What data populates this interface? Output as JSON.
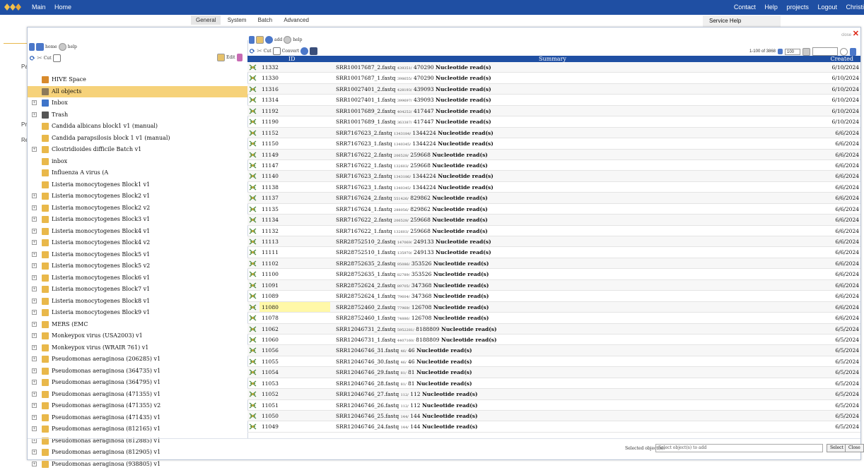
{
  "topbar": {
    "left": [
      "Main",
      "Home"
    ],
    "right": [
      "Contact",
      "Help",
      "projects",
      "Logout",
      "Christi"
    ]
  },
  "bg_tabs": [
    "General",
    "System",
    "Batch",
    "Advanced"
  ],
  "service_help": "Service Help",
  "bg_labels": [
    "Pa",
    "Pro",
    "Re"
  ],
  "left_toolbar": {
    "home_label": "home",
    "help_label": "help",
    "cut_label": "Cut",
    "edit_label": "Edit"
  },
  "tree": [
    {
      "label": "HIVE Space",
      "icon": "home",
      "exp": false
    },
    {
      "label": "All objects",
      "icon": "all",
      "exp": false,
      "selected": true
    },
    {
      "label": "Inbox",
      "icon": "blue",
      "exp": true
    },
    {
      "label": "Trash",
      "icon": "trash",
      "exp": true
    },
    {
      "label": "Candida albicans block1 v1 (manual)",
      "icon": "folder",
      "exp": false
    },
    {
      "label": "Candida parapsilosis block 1 v1 (manual)",
      "icon": "folder",
      "exp": false
    },
    {
      "label": "Clostridioides difficile Batch v1",
      "icon": "folder",
      "exp": true
    },
    {
      "label": "inbox",
      "icon": "folder",
      "exp": false
    },
    {
      "label": "Influenza A virus (A",
      "icon": "folder",
      "exp": false
    },
    {
      "label": "Listeria monocytogenes Block1 v1",
      "icon": "folder",
      "exp": false
    },
    {
      "label": "Listeria monocytogenes Block2 v1",
      "icon": "folder",
      "exp": true
    },
    {
      "label": "Listeria monocytogenes Block2 v2",
      "icon": "folder",
      "exp": true
    },
    {
      "label": "Listeria monocytogenes Block3 v1",
      "icon": "folder",
      "exp": true
    },
    {
      "label": "Listeria monocytogenes Block4 v1",
      "icon": "folder",
      "exp": true
    },
    {
      "label": "Listeria monocytogenes Block4 v2",
      "icon": "folder",
      "exp": true
    },
    {
      "label": "Listeria monocytogenes Block5 v1",
      "icon": "folder",
      "exp": true
    },
    {
      "label": "Listeria monocytogenes Block5 v2",
      "icon": "folder",
      "exp": true
    },
    {
      "label": "Listeria monocytogenes Block6 v1",
      "icon": "folder",
      "exp": true
    },
    {
      "label": "Listeria monocytogenes Block7 v1",
      "icon": "folder",
      "exp": true
    },
    {
      "label": "Listeria monocytogenes Block8 v1",
      "icon": "folder",
      "exp": true
    },
    {
      "label": "Listeria monocytogenes Block9 v1",
      "icon": "folder",
      "exp": true
    },
    {
      "label": "MERS (EMC",
      "icon": "folder",
      "exp": true
    },
    {
      "label": "Monkeypox virus (USA2003) v1",
      "icon": "folder",
      "exp": true
    },
    {
      "label": "Monkeypox virus (WRAIR 761) v1",
      "icon": "folder",
      "exp": true
    },
    {
      "label": "Pseudomonas aeraginosa (206285) v1",
      "icon": "folder",
      "exp": true
    },
    {
      "label": "Pseudomonas aeraginosa (364735) v1",
      "icon": "folder",
      "exp": true
    },
    {
      "label": "Pseudomonas aeraginosa (364795) v1",
      "icon": "folder",
      "exp": true
    },
    {
      "label": "Pseudomonas aeraginosa (471355) v1",
      "icon": "folder",
      "exp": true
    },
    {
      "label": "Pseudomonas aeraginosa (471355) v2",
      "icon": "folder",
      "exp": true
    },
    {
      "label": "Pseudomonas aeraginosa (471435) v1",
      "icon": "folder",
      "exp": true
    },
    {
      "label": "Pseudomonas aeraginosa (812165) v1",
      "icon": "folder",
      "exp": true
    },
    {
      "label": "Pseudomonas aeraginosa (812885) v1",
      "icon": "folder",
      "exp": true
    },
    {
      "label": "Pseudomonas aeraginosa (812905) v1",
      "icon": "folder",
      "exp": true
    },
    {
      "label": "Pseudomonas aeraginosa (938805) v1",
      "icon": "folder",
      "exp": true
    }
  ],
  "right_toolbar": {
    "help_label": "help",
    "add_label": "add",
    "cut_label": "Cut",
    "convert_label": "Convert",
    "close_label": "close"
  },
  "pager": {
    "range": "1-100 of 3868",
    "per_page": "100"
  },
  "grid": {
    "headers": {
      "id": "ID",
      "summary": "Summary",
      "created": "Created"
    },
    "rows": [
      {
        "id": "11332",
        "name": "SRR10017687_2.fastq",
        "small": "439351/",
        "count": "470290",
        "unit": "Nucleotide read(s)",
        "date": "6/10/2024"
      },
      {
        "id": "11330",
        "name": "SRR10017687_1.fastq",
        "small": "398655/",
        "count": "470290",
        "unit": "Nucleotide read(s)",
        "date": "6/10/2024"
      },
      {
        "id": "11316",
        "name": "SRR10027401_2.fastq",
        "small": "428193/",
        "count": "439093",
        "unit": "Nucleotide read(s)",
        "date": "6/10/2024"
      },
      {
        "id": "11314",
        "name": "SRR10027401_1.fastq",
        "small": "399697/",
        "count": "439093",
        "unit": "Nucleotide read(s)",
        "date": "6/10/2024"
      },
      {
        "id": "11192",
        "name": "SRR10017689_2.fastq",
        "small": "404252/",
        "count": "417447",
        "unit": "Nucleotide read(s)",
        "date": "6/10/2024"
      },
      {
        "id": "11190",
        "name": "SRR10017689_1.fastq",
        "small": "363387/",
        "count": "417447",
        "unit": "Nucleotide read(s)",
        "date": "6/10/2024"
      },
      {
        "id": "11152",
        "name": "SRR7167623_2.fastq",
        "small": "1343184/",
        "count": "1344224",
        "unit": "Nucleotide read(s)",
        "date": "6/6/2024"
      },
      {
        "id": "11150",
        "name": "SRR7167623_1.fastq",
        "small": "1340345/",
        "count": "1344224",
        "unit": "Nucleotide read(s)",
        "date": "6/6/2024"
      },
      {
        "id": "11149",
        "name": "SRR7167622_2.fastq",
        "small": "206528/",
        "count": "259668",
        "unit": "Nucleotide read(s)",
        "date": "6/6/2024"
      },
      {
        "id": "11147",
        "name": "SRR7167622_1.fastq",
        "small": "132603/",
        "count": "259668",
        "unit": "Nucleotide read(s)",
        "date": "6/6/2024"
      },
      {
        "id": "11140",
        "name": "SRR7167623_2.fastq",
        "small": "1343186/",
        "count": "1344224",
        "unit": "Nucleotide read(s)",
        "date": "6/6/2024"
      },
      {
        "id": "11138",
        "name": "SRR7167623_1.fastq",
        "small": "1340345/",
        "count": "1344224",
        "unit": "Nucleotide read(s)",
        "date": "6/6/2024"
      },
      {
        "id": "11137",
        "name": "SRR7167624_2.fastq",
        "small": "551426/",
        "count": "829862",
        "unit": "Nucleotide read(s)",
        "date": "6/6/2024"
      },
      {
        "id": "11135",
        "name": "SRR7167624_1.fastq",
        "small": "288056/",
        "count": "829862",
        "unit": "Nucleotide read(s)",
        "date": "6/6/2024"
      },
      {
        "id": "11134",
        "name": "SRR7167622_2.fastq",
        "small": "206528/",
        "count": "259668",
        "unit": "Nucleotide read(s)",
        "date": "6/6/2024"
      },
      {
        "id": "11132",
        "name": "SRR7167622_1.fastq",
        "small": "132603/",
        "count": "259668",
        "unit": "Nucleotide read(s)",
        "date": "6/6/2024"
      },
      {
        "id": "11113",
        "name": "SRR28752510_2.fastq",
        "small": "147069/",
        "count": "249133",
        "unit": "Nucleotide read(s)",
        "date": "6/6/2024"
      },
      {
        "id": "11111",
        "name": "SRR28752510_1.fastq",
        "small": "135970/",
        "count": "249133",
        "unit": "Nucleotide read(s)",
        "date": "6/6/2024"
      },
      {
        "id": "11102",
        "name": "SRR28752635_2.fastq",
        "small": "95086/",
        "count": "353526",
        "unit": "Nucleotide read(s)",
        "date": "6/6/2024"
      },
      {
        "id": "11100",
        "name": "SRR28752635_1.fastq",
        "small": "82789/",
        "count": "353526",
        "unit": "Nucleotide read(s)",
        "date": "6/6/2024"
      },
      {
        "id": "11091",
        "name": "SRR28752624_2.fastq",
        "small": "89705/",
        "count": "347368",
        "unit": "Nucleotide read(s)",
        "date": "6/6/2024"
      },
      {
        "id": "11089",
        "name": "SRR28752624_1.fastq",
        "small": "79604/",
        "count": "347368",
        "unit": "Nucleotide read(s)",
        "date": "6/6/2024"
      },
      {
        "id": "11080",
        "name": "SRR28752460_2.fastq",
        "small": "77969/",
        "count": "126708",
        "unit": "Nucleotide read(s)",
        "date": "6/6/2024",
        "highlight": true
      },
      {
        "id": "11078",
        "name": "SRR28752460_1.fastq",
        "small": "74886/",
        "count": "126708",
        "unit": "Nucleotide read(s)",
        "date": "6/6/2024"
      },
      {
        "id": "11062",
        "name": "SRR12046731_2.fastq",
        "small": "5952281/",
        "count": "8188809",
        "unit": "Nucleotide read(s)",
        "date": "6/5/2024"
      },
      {
        "id": "11060",
        "name": "SRR12046731_1.fastq",
        "small": "4407160/",
        "count": "8188809",
        "unit": "Nucleotide read(s)",
        "date": "6/5/2024"
      },
      {
        "id": "11056",
        "name": "SRR12046746_31.fastq",
        "small": "46/",
        "count": "46",
        "unit": "Nucleotide read(s)",
        "date": "6/5/2024"
      },
      {
        "id": "11055",
        "name": "SRR12046746_30.fastq",
        "small": "46/",
        "count": "46",
        "unit": "Nucleotide read(s)",
        "date": "6/5/2024"
      },
      {
        "id": "11054",
        "name": "SRR12046746_29.fastq",
        "small": "81/",
        "count": "81",
        "unit": "Nucleotide read(s)",
        "date": "6/5/2024"
      },
      {
        "id": "11053",
        "name": "SRR12046746_28.fastq",
        "small": "81/",
        "count": "81",
        "unit": "Nucleotide read(s)",
        "date": "6/5/2024"
      },
      {
        "id": "11052",
        "name": "SRR12046746_27.fastq",
        "small": "112/",
        "count": "112",
        "unit": "Nucleotide read(s)",
        "date": "6/5/2024"
      },
      {
        "id": "11051",
        "name": "SRR12046746_26.fastq",
        "small": "112/",
        "count": "112",
        "unit": "Nucleotide read(s)",
        "date": "6/5/2024"
      },
      {
        "id": "11050",
        "name": "SRR12046746_25.fastq",
        "small": "144/",
        "count": "144",
        "unit": "Nucleotide read(s)",
        "date": "6/5/2024"
      },
      {
        "id": "11049",
        "name": "SRR12046746_24.fastq",
        "small": "144/",
        "count": "144",
        "unit": "Nucleotide read(s)",
        "date": "6/5/2024"
      }
    ]
  },
  "footer": {
    "label": "Selected object(s):",
    "placeholder": "Select object(s) to add",
    "select_label": "Select",
    "close_label": "Close"
  }
}
